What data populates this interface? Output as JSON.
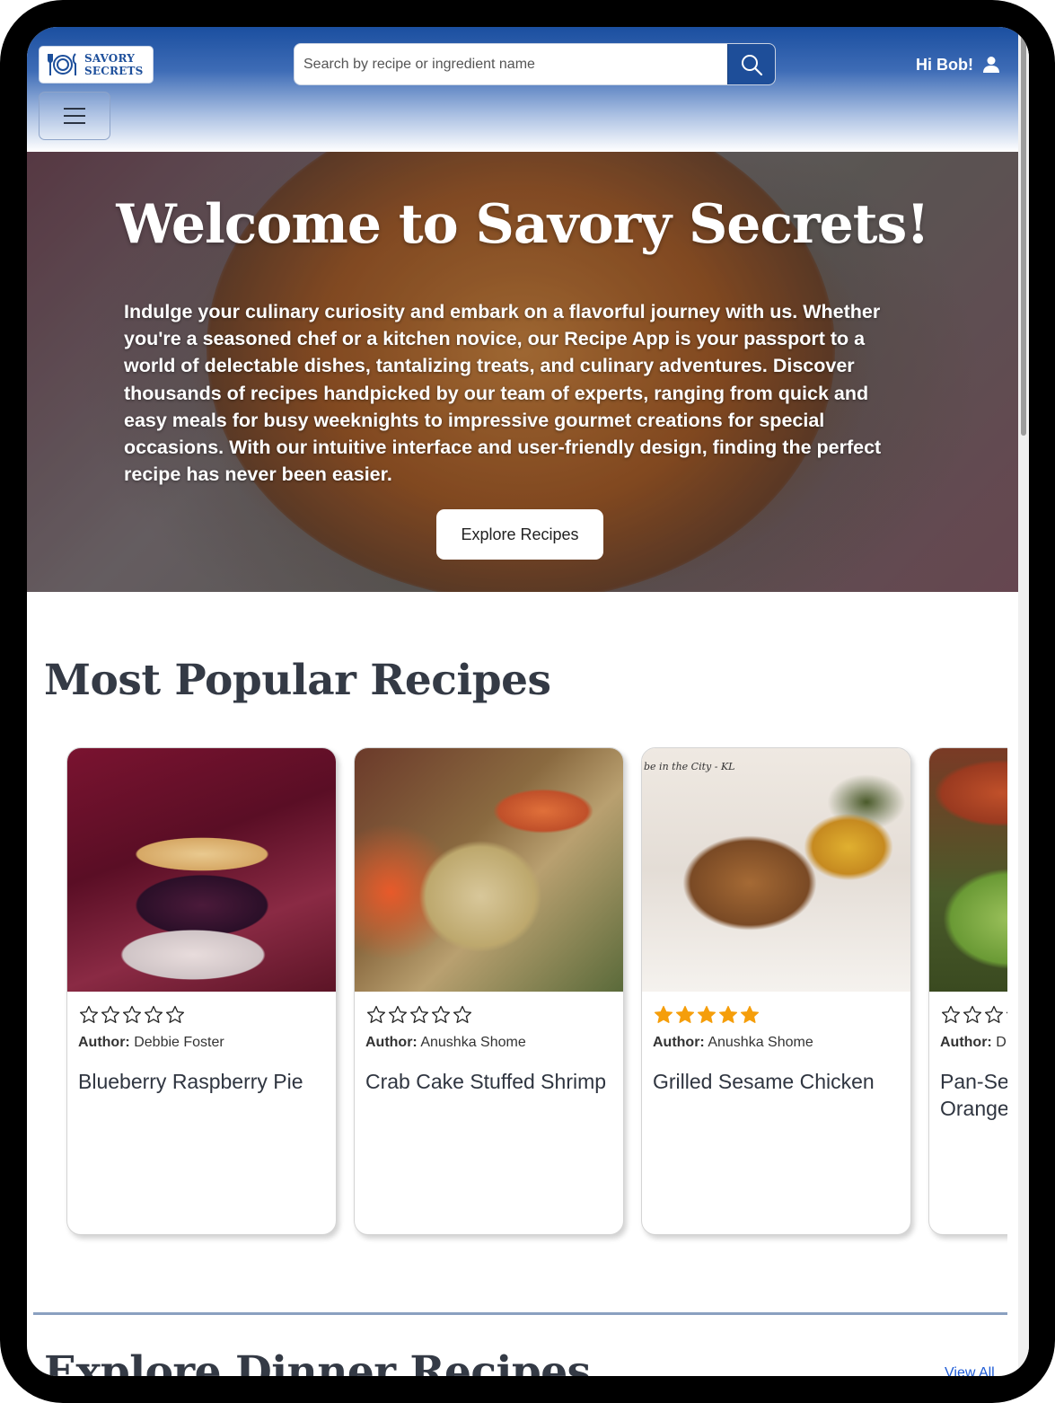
{
  "header": {
    "logo_line1": "SAVORY",
    "logo_line2": "SECRETS",
    "search_placeholder": "Search by recipe or ingredient name",
    "search_icon": "search-icon",
    "greeting": "Hi Bob!",
    "user_icon": "user-icon",
    "menu_icon": "hamburger-menu-icon",
    "brand_color": "#1e4e99"
  },
  "hero": {
    "title": "Welcome to Savory Secrets!",
    "text": "Indulge your culinary curiosity and embark on a flavorful journey with us. Whether you're a seasoned chef or a kitchen novice, our Recipe App is your passport to a world of delectable dishes, tantalizing treats, and culinary adventures. Discover thousands of recipes handpicked by our team of experts, ranging from quick and easy meals for busy weeknights to impressive gourmet creations for special occasions. With our intuitive interface and user-friendly design, finding the perfect recipe has never been easier.",
    "button": "Explore Recipes"
  },
  "popular": {
    "title": "Most Popular Recipes",
    "author_label": "Author:",
    "cards": [
      {
        "author": "Debbie Foster",
        "title": "Blueberry Raspberry Pie",
        "rating": 0
      },
      {
        "author": "Anushka Shome",
        "title": "Crab Cake Stuffed Shrimp",
        "rating": 0
      },
      {
        "author": "Anushka Shome",
        "title": "Grilled Sesame Chicken",
        "rating": 5,
        "image_caption": "be in the City - KL"
      },
      {
        "author": "D",
        "title": "Pan-Se Orange",
        "rating": 0
      }
    ],
    "star_color": "#f59e0b"
  },
  "dinner": {
    "title": "Explore Dinner Recipes",
    "view_all": "View All"
  }
}
